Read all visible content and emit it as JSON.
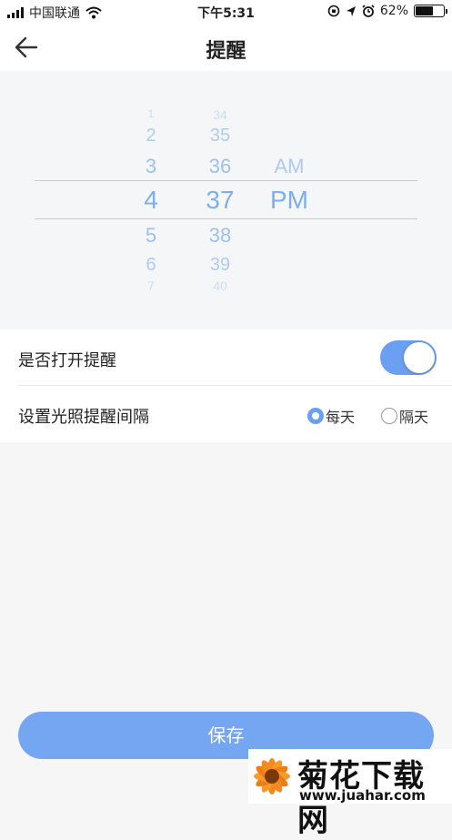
{
  "status_bar": {
    "carrier": "中国联通",
    "time": "下午5:31",
    "battery": "62%"
  },
  "header": {
    "title": "提醒"
  },
  "picker": {
    "hours": [
      "1",
      "2",
      "3",
      "4",
      "5",
      "6",
      "7"
    ],
    "minutes": [
      "34",
      "35",
      "36",
      "37",
      "38",
      "39",
      "40"
    ],
    "ampm": [
      "AM",
      "PM"
    ],
    "selected": {
      "hour": "4",
      "minute": "37",
      "ampm": "PM"
    }
  },
  "settings": {
    "reminder_toggle": {
      "label": "是否打开提醒",
      "on": true
    },
    "interval": {
      "label": "设置光照提醒间隔",
      "options": [
        "每天",
        "隔天"
      ],
      "selected": "每天"
    }
  },
  "save_button": {
    "label": "保存"
  },
  "watermark": {
    "title": "菊花下载网",
    "url": "www.juahar.com"
  },
  "colors": {
    "accent": "#6a9ff1",
    "picker_text": "#80aeea"
  }
}
